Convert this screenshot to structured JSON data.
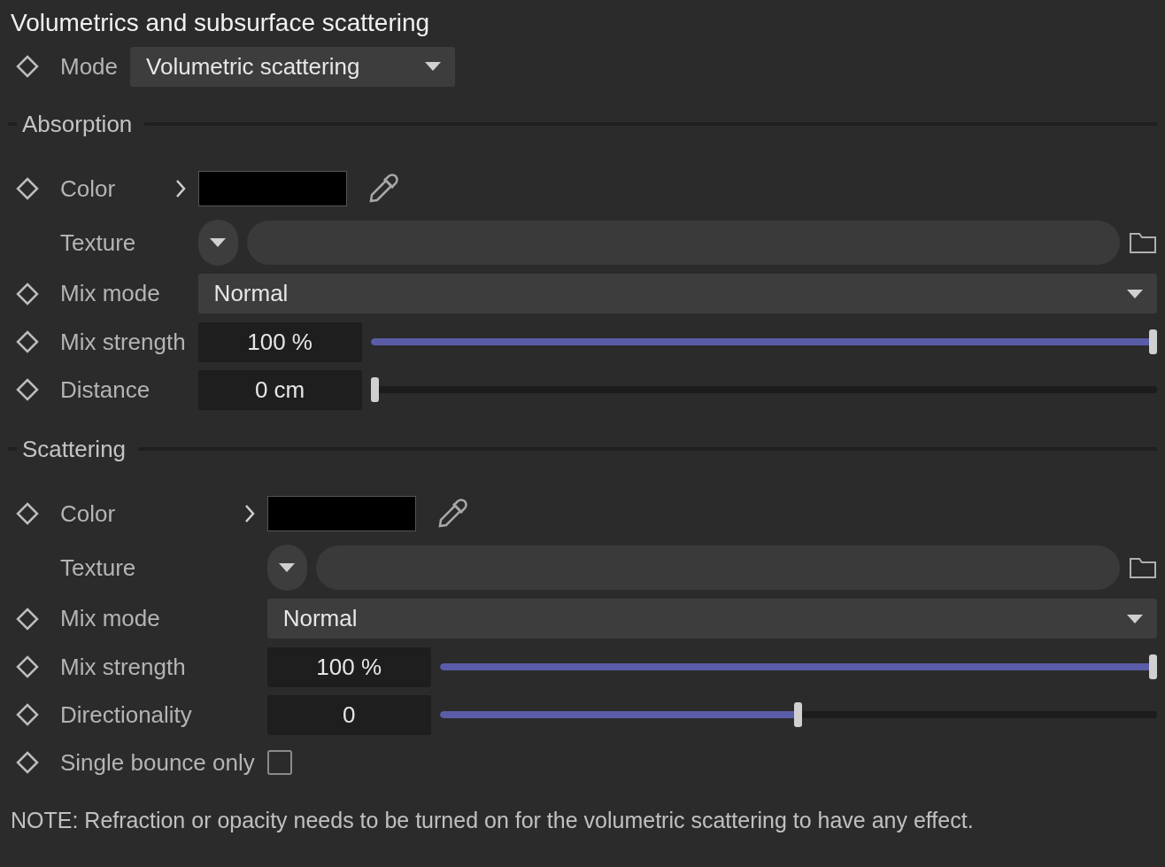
{
  "title": "Volumetrics and subsurface scattering",
  "mode": {
    "label": "Mode",
    "value": "Volumetric scattering"
  },
  "sections": [
    {
      "heading": "Absorption",
      "rows": [
        {
          "kind": "color",
          "label": "Color",
          "animatable": true,
          "color": "#000000"
        },
        {
          "kind": "texture",
          "label": "Texture",
          "animatable": false
        },
        {
          "kind": "dropdown",
          "label": "Mix mode",
          "animatable": true,
          "value": "Normal"
        },
        {
          "kind": "slider",
          "label": "Mix strength",
          "animatable": true,
          "value": "100 %",
          "level": 1
        },
        {
          "kind": "slider",
          "label": "Distance",
          "animatable": true,
          "value": "0 cm",
          "level": 0
        }
      ]
    },
    {
      "heading": "Scattering",
      "rows": [
        {
          "kind": "color",
          "label": "Color",
          "animatable": true,
          "color": "#000000"
        },
        {
          "kind": "texture",
          "label": "Texture",
          "animatable": false
        },
        {
          "kind": "dropdown",
          "label": "Mix mode",
          "animatable": true,
          "value": "Normal"
        },
        {
          "kind": "slider",
          "label": "Mix strength",
          "animatable": true,
          "value": "100 %",
          "level": 1
        },
        {
          "kind": "slider",
          "label": "Directionality",
          "animatable": true,
          "value": "0",
          "level": 0.5
        },
        {
          "kind": "checkbox",
          "label": "Single bounce only",
          "animatable": true,
          "checked": false
        }
      ]
    }
  ],
  "note": "NOTE: Refraction or opacity needs to be turned on for the volumetric scattering to have any effect."
}
